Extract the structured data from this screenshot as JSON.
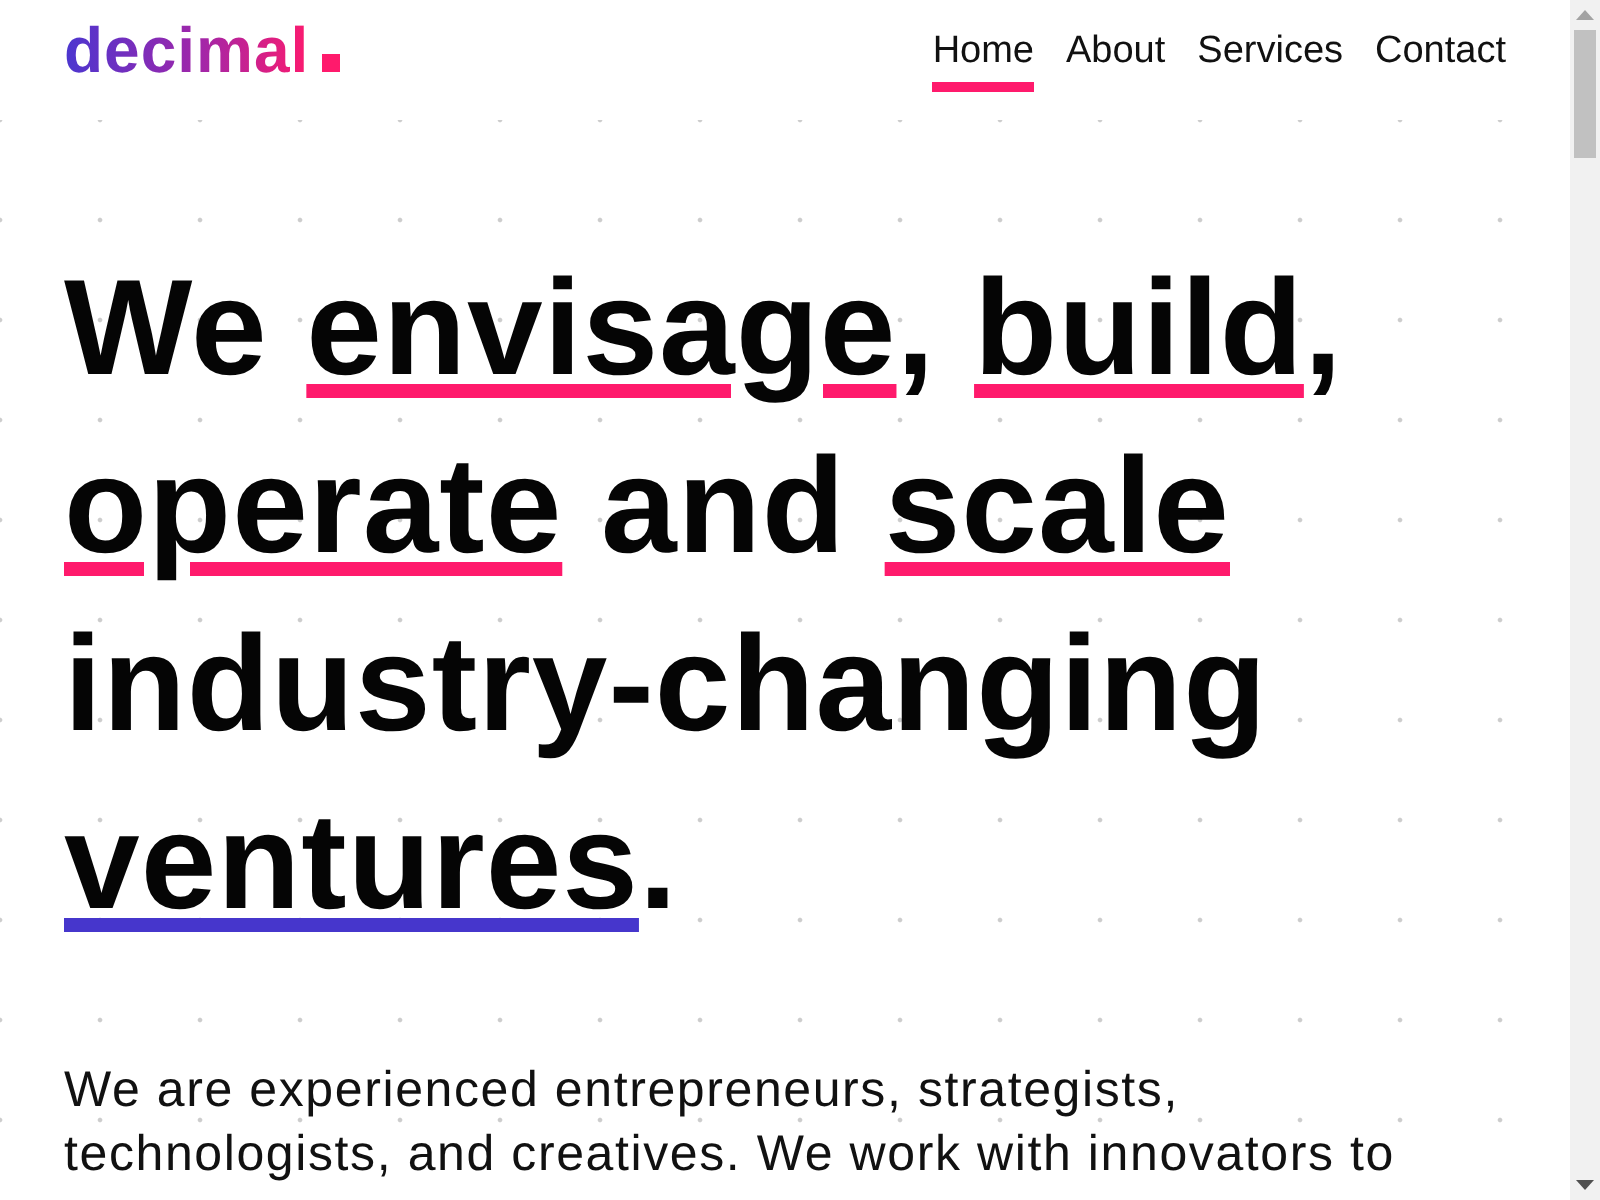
{
  "header": {
    "logo": {
      "text": "decimal"
    },
    "nav": [
      {
        "label": "Home",
        "selected": true
      },
      {
        "label": "About",
        "selected": false
      },
      {
        "label": "Services",
        "selected": false
      },
      {
        "label": "Contact",
        "selected": false
      }
    ]
  },
  "hero": {
    "headline": [
      {
        "text": "We ",
        "underlined": false
      },
      {
        "text": "envisage",
        "underlined": true,
        "color": "#ff1a6c"
      },
      {
        "text": ", ",
        "underlined": false
      },
      {
        "text": "build",
        "underlined": true,
        "color": "#ff1a6c"
      },
      {
        "text": ", ",
        "underlined": false
      },
      {
        "text": "operate",
        "underlined": true,
        "color": "#ff1a6c"
      },
      {
        "text": " and ",
        "underlined": false
      },
      {
        "text": "scale",
        "underlined": true,
        "color": "#ff1a6c"
      },
      {
        "text": " industry-changing ",
        "underlined": false
      },
      {
        "text": "ventures",
        "underlined": true,
        "color": "#4636cc"
      },
      {
        "text": ".",
        "underlined": false
      }
    ],
    "intro": "We are experienced entrepreneurs, strategists, technologists, and creatives. We work with innovators to"
  }
}
